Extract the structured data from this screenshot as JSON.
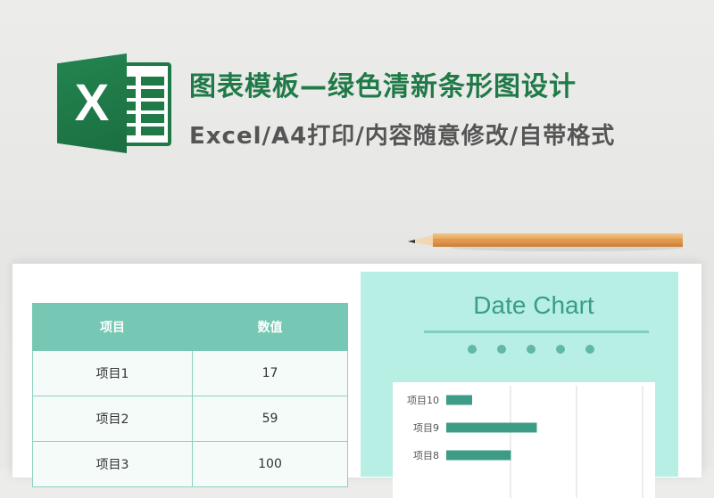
{
  "banner": {
    "logo_letter": "X",
    "title": "图表模板—绿色清新条形图设计",
    "subtitle": "Excel/A4打印/内容随意修改/自带格式"
  },
  "colors": {
    "brand_green": "#1f7a48",
    "table_header": "#76c8b4",
    "chart_panel": "#b7efe4",
    "bar": "#3d9c85"
  },
  "table": {
    "headers": [
      "项目",
      "数值"
    ],
    "rows": [
      {
        "item": "项目1",
        "value": "17"
      },
      {
        "item": "项目2",
        "value": "59"
      },
      {
        "item": "项目3",
        "value": "100"
      }
    ]
  },
  "chart_data": {
    "type": "bar",
    "title": "Date Chart",
    "categories": [
      "项目10",
      "项目9",
      "项目8"
    ],
    "values": [
      10,
      35,
      25
    ],
    "orientation": "horizontal",
    "grid": true
  }
}
